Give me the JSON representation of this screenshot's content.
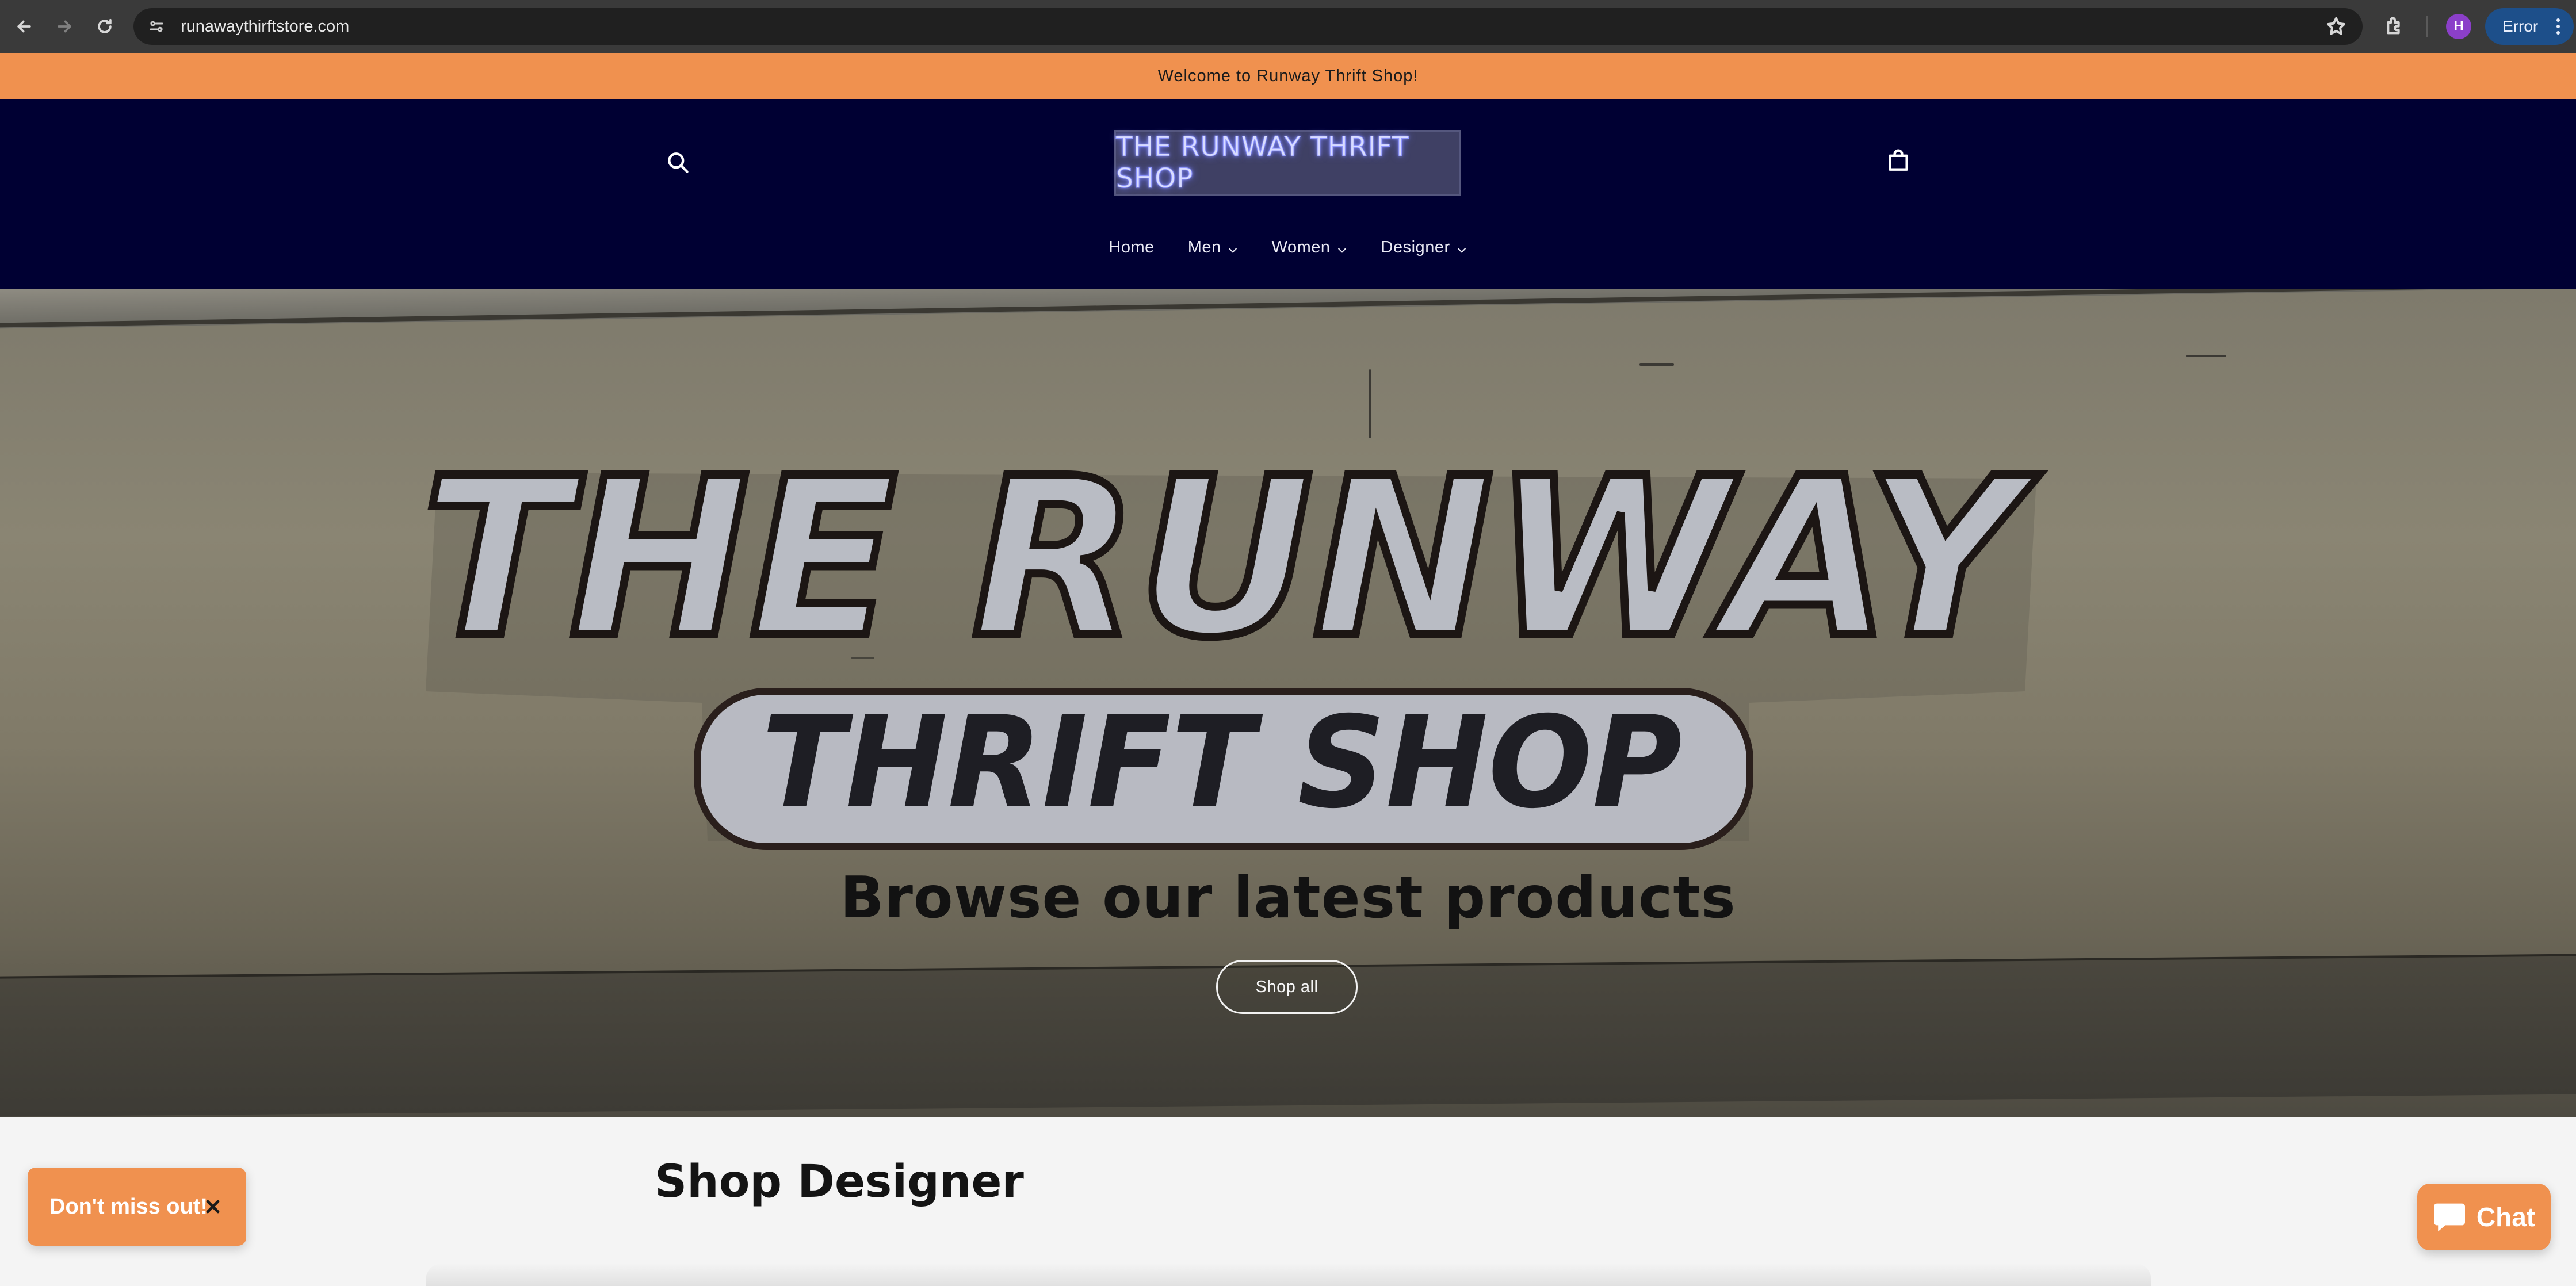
{
  "browser": {
    "url": "runawaythirftstore.com",
    "avatar_letter": "H",
    "error_label": "Error",
    "icons": [
      "back-arrow-icon",
      "forward-arrow-icon",
      "reload-icon",
      "site-settings-icon",
      "bookmark-star-icon",
      "extensions-icon",
      "kebab-menu-icon"
    ]
  },
  "announcement": {
    "text": "Welcome to Runway Thrift Shop!",
    "background": "#f0914f"
  },
  "header": {
    "background": "#000033",
    "logo_text": "THE RUNWAY THRIFT SHOP",
    "nav": [
      {
        "label": "Home",
        "has_dropdown": false
      },
      {
        "label": "Men",
        "has_dropdown": true
      },
      {
        "label": "Women",
        "has_dropdown": true
      },
      {
        "label": "Designer",
        "has_dropdown": true
      }
    ]
  },
  "hero": {
    "sign_line1": "THE RUNWAY",
    "sign_line2": "THRIFT SHOP",
    "heading": "Browse our latest products",
    "button_label": "Shop all"
  },
  "sections": {
    "shop_designer_title": "Shop Designer"
  },
  "popups": {
    "toast_text": "Don't miss out!",
    "chat_label": "Chat",
    "accent": "#f0914f"
  }
}
